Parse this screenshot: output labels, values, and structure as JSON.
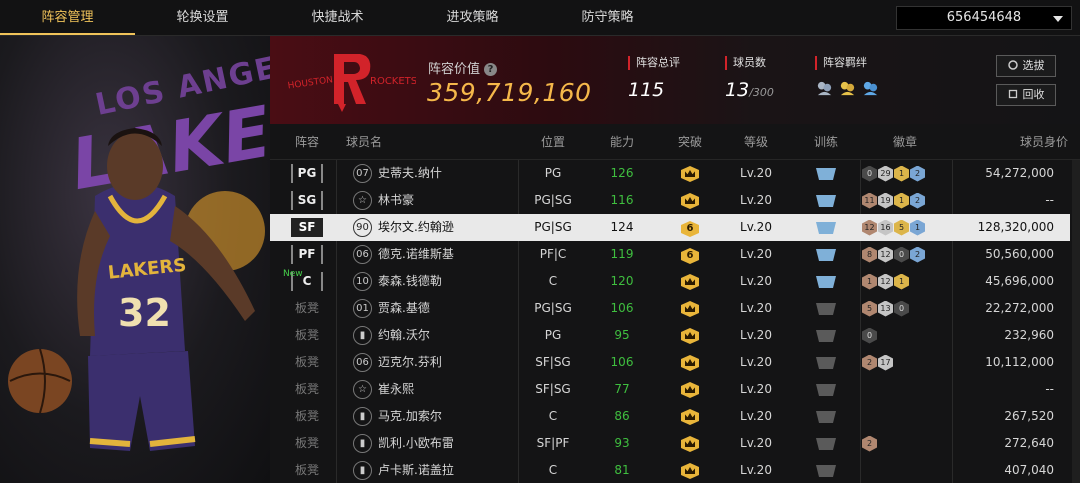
{
  "tabs": [
    {
      "label": "阵容管理",
      "active": true
    },
    {
      "label": "轮换设置",
      "active": false
    },
    {
      "label": "快捷战术",
      "active": false
    },
    {
      "label": "进攻策略",
      "active": false
    },
    {
      "label": "防守策略",
      "active": false
    }
  ],
  "account": {
    "value": "656454648"
  },
  "header": {
    "value_label": "阵容价值",
    "value": "359,719,160",
    "overall_label": "阵容总评",
    "overall": "115",
    "count_label": "球员数",
    "count": "13",
    "count_max": "/300",
    "bond_label": "阵容羁绊",
    "select_label": "选拔",
    "recycle_label": "回收"
  },
  "columns": [
    "阵容",
    "球员名",
    "位置",
    "能力",
    "突破",
    "等级",
    "训练",
    "徽章",
    "球员身价"
  ],
  "rows": [
    {
      "slot": "PG",
      "new": "",
      "num": "07",
      "name": "史蒂夫.纳什",
      "pos": "PG",
      "ability": "126",
      "breakthrough": "",
      "level": "Lv.20",
      "train": true,
      "badges": [
        {
          "t": "dark",
          "v": "0"
        },
        {
          "t": "silver",
          "v": "29"
        },
        {
          "t": "gold",
          "v": "1"
        },
        {
          "t": "blue",
          "v": "2"
        }
      ],
      "value": "54,272,000",
      "selected": false,
      "bench": false
    },
    {
      "slot": "SG",
      "new": "",
      "num": "☆",
      "name": "林书豪",
      "pos": "PG|SG",
      "ability": "116",
      "breakthrough": "",
      "level": "Lv.20",
      "train": true,
      "badges": [
        {
          "t": "bronze",
          "v": "11"
        },
        {
          "t": "silver",
          "v": "19"
        },
        {
          "t": "gold",
          "v": "1"
        },
        {
          "t": "blue",
          "v": "2"
        }
      ],
      "value": "--",
      "selected": false,
      "bench": false
    },
    {
      "slot": "SF",
      "new": "",
      "num": "90",
      "name": "埃尔文.约翰逊",
      "pos": "PG|SG",
      "ability": "124",
      "breakthrough": "6",
      "level": "Lv.20",
      "train": true,
      "badges": [
        {
          "t": "bronze",
          "v": "12"
        },
        {
          "t": "silver",
          "v": "16"
        },
        {
          "t": "gold",
          "v": "5"
        },
        {
          "t": "blue",
          "v": "1"
        }
      ],
      "value": "128,320,000",
      "selected": true,
      "bench": false
    },
    {
      "slot": "PF",
      "new": "",
      "num": "06",
      "name": "德克.诺维斯基",
      "pos": "PF|C",
      "ability": "119",
      "breakthrough": "6",
      "level": "Lv.20",
      "train": true,
      "badges": [
        {
          "t": "bronze",
          "v": "8"
        },
        {
          "t": "silver",
          "v": "12"
        },
        {
          "t": "dark",
          "v": "0"
        },
        {
          "t": "blue",
          "v": "2"
        }
      ],
      "value": "50,560,000",
      "selected": false,
      "bench": false
    },
    {
      "slot": "C",
      "new": "New",
      "num": "10",
      "name": "泰森.钱德勒",
      "pos": "C",
      "ability": "120",
      "breakthrough": "",
      "level": "Lv.20",
      "train": true,
      "badges": [
        {
          "t": "bronze",
          "v": "1"
        },
        {
          "t": "silver",
          "v": "12"
        },
        {
          "t": "gold",
          "v": "1"
        }
      ],
      "value": "45,696,000",
      "selected": false,
      "bench": false
    },
    {
      "slot": "板凳",
      "new": "",
      "num": "01",
      "name": "贾森.基德",
      "pos": "PG|SG",
      "ability": "106",
      "breakthrough": "",
      "level": "Lv.20",
      "train": false,
      "badges": [
        {
          "t": "bronze",
          "v": "5"
        },
        {
          "t": "silver",
          "v": "13"
        },
        {
          "t": "dark",
          "v": "0"
        }
      ],
      "value": "22,272,000",
      "selected": false,
      "bench": true
    },
    {
      "slot": "板凳",
      "new": "",
      "num": "",
      "name": "约翰.沃尔",
      "pos": "PG",
      "ability": "95",
      "breakthrough": "",
      "level": "Lv.20",
      "train": false,
      "badges": [
        {
          "t": "dark",
          "v": "0"
        }
      ],
      "value": "232,960",
      "selected": false,
      "bench": true
    },
    {
      "slot": "板凳",
      "new": "",
      "num": "06",
      "name": "迈克尔.芬利",
      "pos": "SF|SG",
      "ability": "106",
      "breakthrough": "",
      "level": "Lv.20",
      "train": false,
      "badges": [
        {
          "t": "bronze",
          "v": "2"
        },
        {
          "t": "silver",
          "v": "17"
        }
      ],
      "value": "10,112,000",
      "selected": false,
      "bench": true
    },
    {
      "slot": "板凳",
      "new": "",
      "num": "☆",
      "name": "崔永熙",
      "pos": "SF|SG",
      "ability": "77",
      "breakthrough": "",
      "level": "Lv.20",
      "train": false,
      "badges": [],
      "value": "--",
      "selected": false,
      "bench": true
    },
    {
      "slot": "板凳",
      "new": "",
      "num": "",
      "name": "马克.加索尔",
      "pos": "C",
      "ability": "86",
      "breakthrough": "",
      "level": "Lv.20",
      "train": false,
      "badges": [],
      "value": "267,520",
      "selected": false,
      "bench": true
    },
    {
      "slot": "板凳",
      "new": "",
      "num": "",
      "name": "凯利.小欧布雷",
      "pos": "SF|PF",
      "ability": "93",
      "breakthrough": "",
      "level": "Lv.20",
      "train": false,
      "badges": [
        {
          "t": "bronze",
          "v": "2"
        }
      ],
      "value": "272,640",
      "selected": false,
      "bench": true
    },
    {
      "slot": "板凳",
      "new": "",
      "num": "",
      "name": "卢卡斯.诺盖拉",
      "pos": "C",
      "ability": "81",
      "breakthrough": "",
      "level": "Lv.20",
      "train": false,
      "badges": [],
      "value": "407,040",
      "selected": false,
      "bench": true
    }
  ],
  "colors": {
    "accent": "#f0c35a",
    "value": "#f5b84a",
    "ability": "#3fbf3f",
    "rockets_red": "#d2232a"
  }
}
